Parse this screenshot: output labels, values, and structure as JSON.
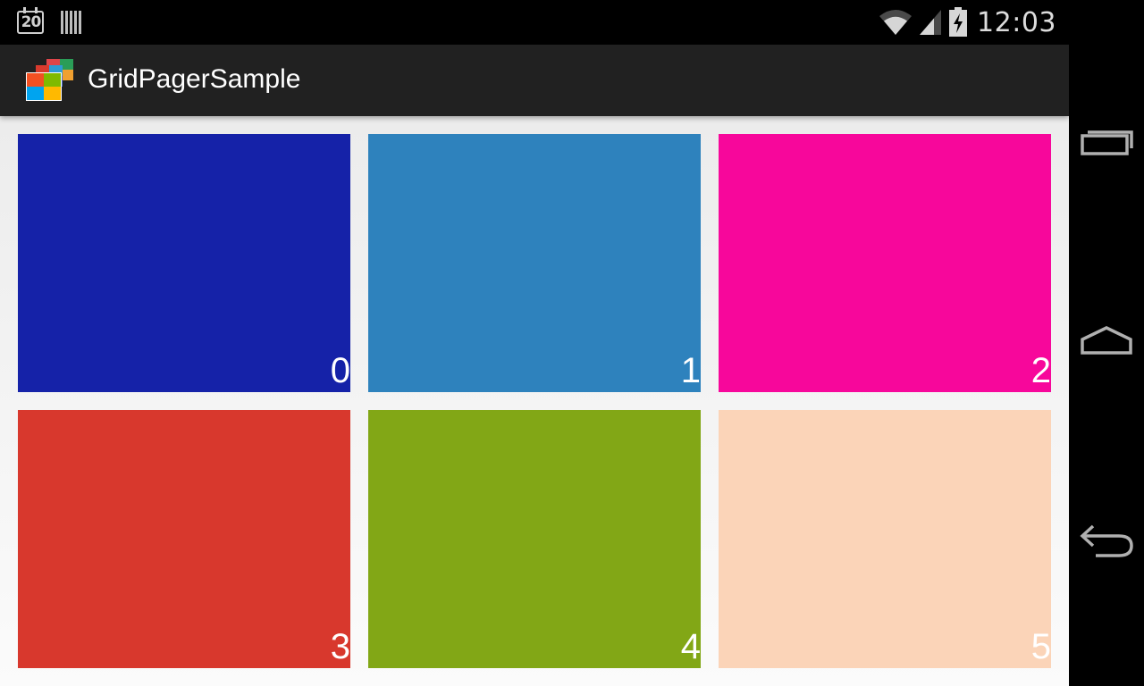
{
  "status_bar": {
    "calendar_date": "20",
    "time": "12:03",
    "icons": [
      "calendar-icon",
      "notification-bars-icon",
      "wifi-icon",
      "signal-icon",
      "battery-charging-icon"
    ]
  },
  "action_bar": {
    "app_icon": "gridpager-app-icon",
    "title": "GridPagerSample"
  },
  "grid": {
    "tiles": [
      {
        "label": "0",
        "color": "#1522a8"
      },
      {
        "label": "1",
        "color": "#2e82bd"
      },
      {
        "label": "2",
        "color": "#f7079b"
      },
      {
        "label": "3",
        "color": "#d8382d"
      },
      {
        "label": "4",
        "color": "#82a716"
      },
      {
        "label": "5",
        "color": "#fbd4b8"
      }
    ]
  },
  "nav_bar": {
    "buttons": [
      "recent-apps-icon",
      "home-icon",
      "back-icon"
    ]
  }
}
